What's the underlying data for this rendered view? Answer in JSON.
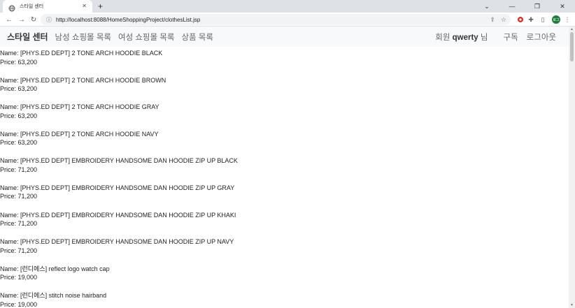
{
  "browser": {
    "tab_title": "스타일 센터",
    "new_tab": "+",
    "url": "http://localhost:8088/HomeShoppingProject/clothesList.jsp",
    "profile_initials": "로그"
  },
  "navbar": {
    "brand": "스타일 센터",
    "links": [
      "남성 쇼핑몰 목록",
      "여성 쇼핑몰 목록",
      "상품 목록"
    ],
    "member_prefix": "회원",
    "member_name": "qwerty",
    "member_suffix": "님",
    "subscribe": "구독",
    "logout": "로그아웃"
  },
  "labels": {
    "name": "Name: ",
    "price": "Price: "
  },
  "products": [
    {
      "name": "[PHYS.ED DEPT] 2 TONE ARCH HOODIE BLACK",
      "price": "63,200"
    },
    {
      "name": "[PHYS.ED DEPT] 2 TONE ARCH HOODIE BROWN",
      "price": "63,200"
    },
    {
      "name": "[PHYS.ED DEPT] 2 TONE ARCH HOODIE GRAY",
      "price": "63,200"
    },
    {
      "name": "[PHYS.ED DEPT] 2 TONE ARCH HOODIE NAVY",
      "price": "63,200"
    },
    {
      "name": "[PHYS.ED DEPT] EMBROIDERY HANDSOME DAN HOODIE ZIP UP BLACK",
      "price": "71,200"
    },
    {
      "name": "[PHYS.ED DEPT] EMBROIDERY HANDSOME DAN HOODIE ZIP UP GRAY",
      "price": "71,200"
    },
    {
      "name": "[PHYS.ED DEPT] EMBROIDERY HANDSOME DAN HOODIE ZIP UP KHAKI",
      "price": "71,200"
    },
    {
      "name": "[PHYS.ED DEPT] EMBROIDERY HANDSOME DAN HOODIE ZIP UP NAVY",
      "price": "71,200"
    },
    {
      "name": "[런디에스] reflect logo watch cap",
      "price": "19,000"
    },
    {
      "name": "[런디에스] stitch noise hairband",
      "price": "19,000"
    }
  ]
}
